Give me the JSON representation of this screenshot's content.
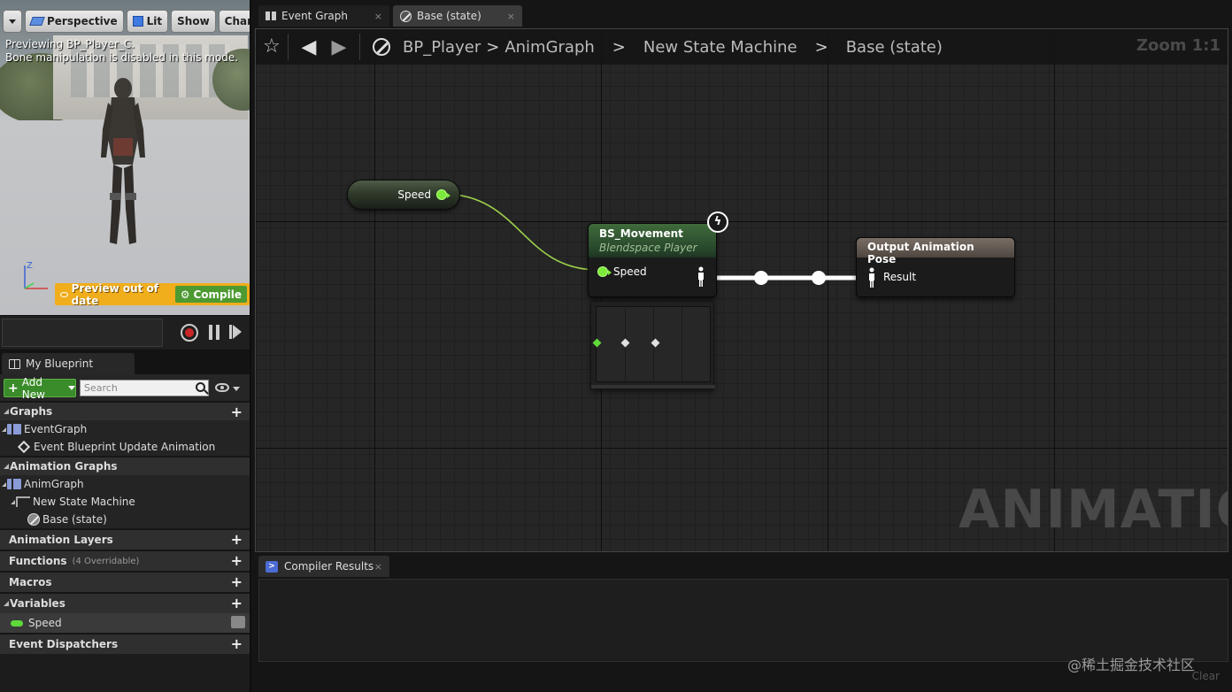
{
  "viewport": {
    "menu_icon": "chevron-down-icon",
    "buttons": [
      {
        "label": "Perspective",
        "icon": "perspective-icon"
      },
      {
        "label": "Lit",
        "icon": "cube-icon"
      },
      {
        "label": "Show"
      },
      {
        "label": "Characte"
      }
    ],
    "preview_text": "Previewing BP_Player_C.",
    "bone_text": "Bone manipulation is disabled in this mode.",
    "preview_out_of_date": "Preview out of date",
    "compile_label": "Compile",
    "axis": {
      "z": "Z"
    }
  },
  "my_blueprint": {
    "tab_label": "My Blueprint",
    "add_new_label": "Add New",
    "search_placeholder": "Search",
    "sections": {
      "graphs": "Graphs",
      "animation_graphs": "Animation Graphs",
      "animation_layers": "Animation Layers",
      "functions": "Functions",
      "functions_sub": "(4 Overridable)",
      "macros": "Macros",
      "variables": "Variables",
      "event_dispatchers": "Event Dispatchers"
    },
    "graphs_items": [
      "EventGraph",
      "Event Blueprint Update Animation"
    ],
    "anim_items": [
      "AnimGraph",
      "New State Machine",
      "Base (state)"
    ],
    "variables": [
      "Speed"
    ],
    "accent_add": "#3a8b2a",
    "variable_color": "#5fd93a"
  },
  "tabs": [
    {
      "label": "Event Graph",
      "close": "×"
    },
    {
      "label": "Base (state)",
      "close": "×"
    }
  ],
  "breadcrumb": {
    "items": [
      "BP_Player",
      "AnimGraph",
      "New State Machine",
      "Base (state)"
    ],
    "separators": [
      ">",
      ">",
      ">"
    ],
    "zoom": "Zoom 1:1"
  },
  "graph": {
    "watermark": "ANIMATION",
    "getter_label": "Speed",
    "bs_node": {
      "title": "BS_Movement",
      "subtitle": "Blendspace Player",
      "pin": "Speed"
    },
    "output_node": {
      "title": "Output Animation Pose",
      "pin": "Result"
    }
  },
  "compiler": {
    "tab_label": "Compiler Results",
    "close": "×",
    "clear_label": "Clear",
    "credit": "@稀土掘金技术社区"
  }
}
